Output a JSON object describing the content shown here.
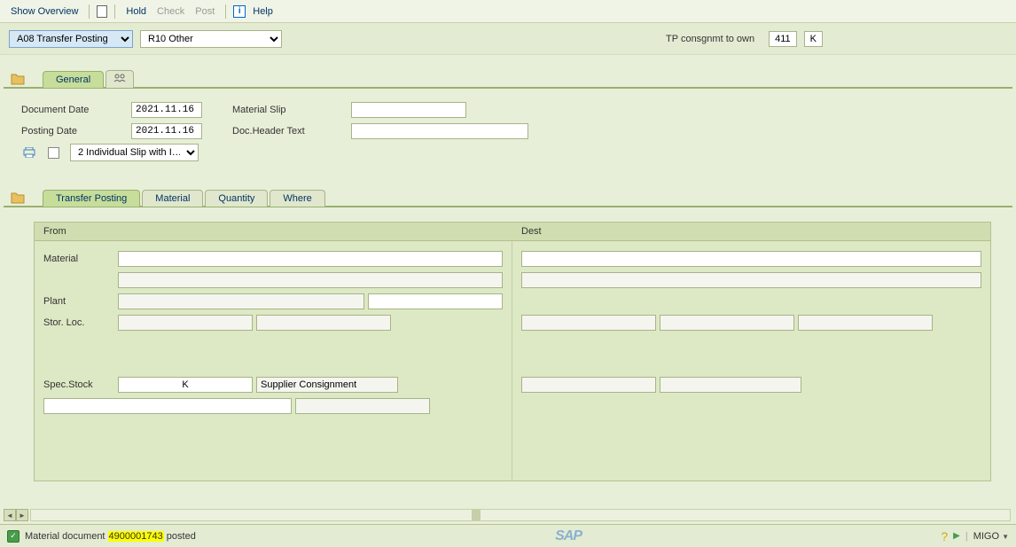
{
  "toolbar": {
    "show_overview": "Show Overview",
    "hold": "Hold",
    "check": "Check",
    "post": "Post",
    "help": "Help"
  },
  "selectors": {
    "action": "A08 Transfer Posting",
    "reference": "R10 Other",
    "right_label": "TP consgnmt to own",
    "movement_type": "411",
    "special_stock": "K"
  },
  "header_tabs": {
    "general": "General"
  },
  "header_form": {
    "doc_date_label": "Document Date",
    "doc_date": "2021.11.16",
    "posting_date_label": "Posting Date",
    "posting_date": "2021.11.16",
    "material_slip_label": "Material Slip",
    "material_slip": "",
    "doc_header_text_label": "Doc.Header Text",
    "doc_header_text": "",
    "print_option": "2 Individual Slip with I…"
  },
  "detail_tabs": {
    "transfer_posting": "Transfer Posting",
    "material": "Material",
    "quantity": "Quantity",
    "where": "Where"
  },
  "from_dest": {
    "from_label": "From",
    "dest_label": "Dest",
    "material_label": "Material",
    "plant_label": "Plant",
    "stor_loc_label": "Stor. Loc.",
    "spec_stock_label": "Spec.Stock",
    "spec_stock_code": "K",
    "spec_stock_text": "Supplier Consignment"
  },
  "status": {
    "message_prefix": "Material document ",
    "doc_number": "4900001743",
    "message_suffix": " posted",
    "tcode": "MIGO"
  }
}
